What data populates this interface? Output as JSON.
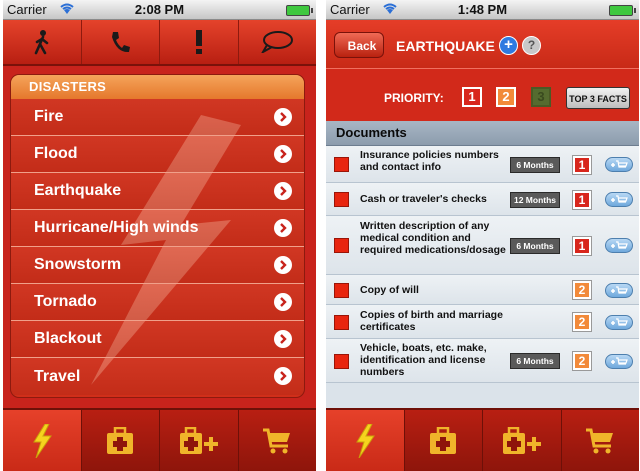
{
  "status_left": {
    "carrier": "Carrier",
    "time": "2:08 PM"
  },
  "status_right": {
    "carrier": "Carrier",
    "time": "1:48 PM"
  },
  "top_toolbar": {
    "items": [
      {
        "icon": "walking-person-icon"
      },
      {
        "icon": "phone-icon"
      },
      {
        "icon": "exclamation-icon"
      },
      {
        "icon": "speech-bubble-icon"
      }
    ]
  },
  "disasters": {
    "header": "DISASTERS",
    "items": [
      "Fire",
      "Flood",
      "Earthquake",
      "Hurricane/High winds",
      "Snowstorm",
      "Tornado",
      "Blackout",
      "Travel"
    ]
  },
  "tabbar": {
    "tabs": [
      {
        "icon": "lightning-icon",
        "active": true
      },
      {
        "icon": "first-aid-kit-icon",
        "active": false
      },
      {
        "icon": "first-aid-kit-plus-icon",
        "active": false
      },
      {
        "icon": "shopping-cart-icon",
        "active": false
      }
    ]
  },
  "detail": {
    "back_label": "Back",
    "title": "EARTHQUAKE",
    "plus_glyph": "+",
    "help_glyph": "?",
    "priority_label": "PRIORITY:",
    "priority_values": [
      "1",
      "2",
      "3"
    ],
    "top3_label": "TOP 3 FACTS",
    "documents_header": "Documents",
    "documents": [
      {
        "text": "Insurance policies numbers and contact info",
        "months": "6 Months",
        "priority": "1"
      },
      {
        "text": "Cash or traveler's checks",
        "months": "12 Months",
        "priority": "1"
      },
      {
        "text": "Written description of any medical condition and required medications/dosage",
        "months": "6 Months",
        "priority": "1"
      },
      {
        "text": "Copy of will",
        "months": "",
        "priority": "2"
      },
      {
        "text": "Copies of birth and marriage certificates",
        "months": "",
        "priority": "2"
      },
      {
        "text": "Vehicle, boats, etc. make, identification and license numbers",
        "months": "6 Months",
        "priority": "2"
      }
    ]
  },
  "colors": {
    "accent_red": "#c8231c",
    "header_orange": "#e5782c",
    "priority_red": "#d8261c",
    "priority_orange": "#f28a3a",
    "document_background": "#dbe3ea"
  }
}
